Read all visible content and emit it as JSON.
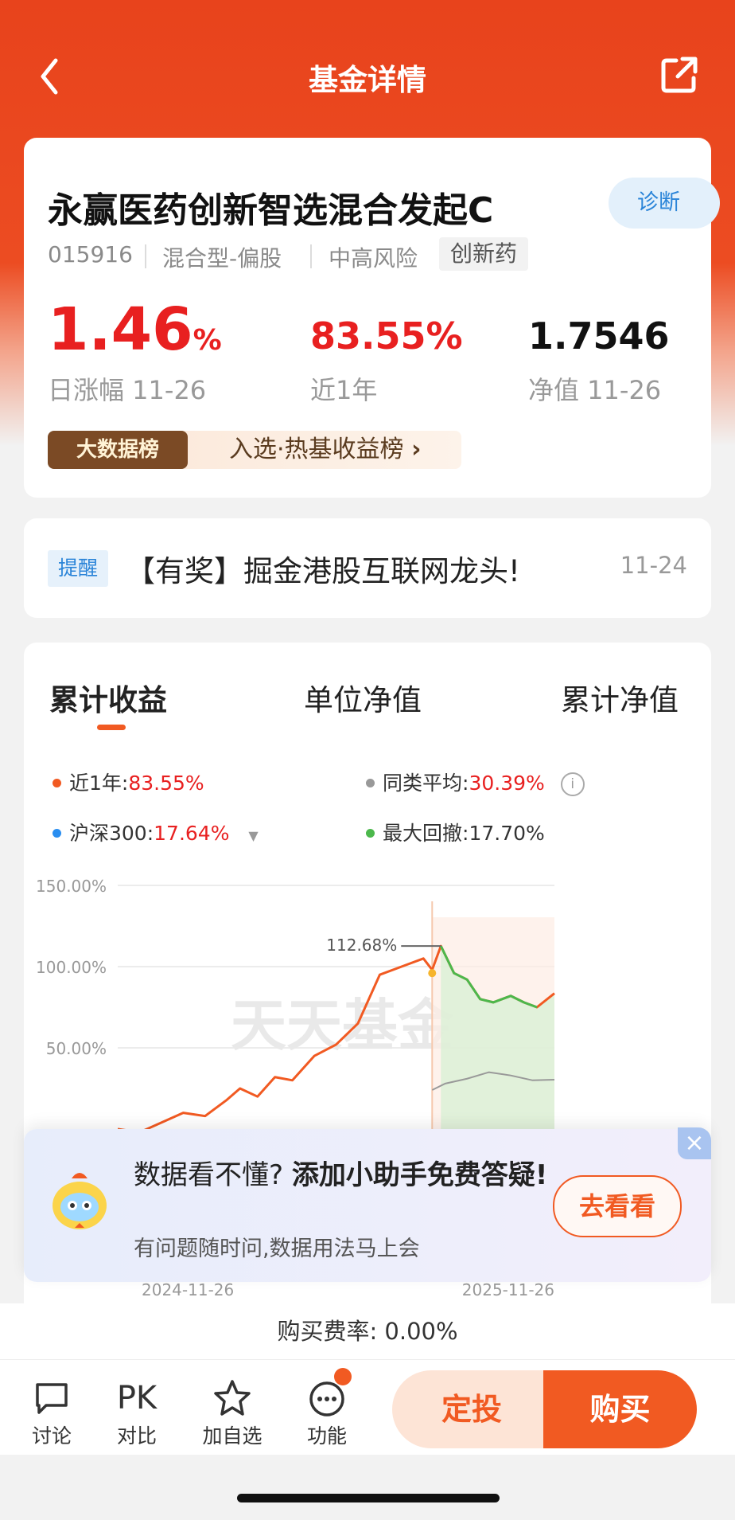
{
  "nav": {
    "title": "基金详情"
  },
  "fund": {
    "name": "永赢医药创新智选混合发起C",
    "diagnose_label": "诊断",
    "code": "015916",
    "type": "混合型-偏股",
    "risk": "中高风险",
    "tag": "创新药",
    "daily_change": "1.46",
    "daily_change_unit": "%",
    "daily_change_label": "日涨幅 11-26",
    "one_year_return": "83.55%",
    "one_year_label": "近1年",
    "nav_value": "1.7546",
    "nav_label": "净值 11-26",
    "rank_badge": "大数据榜",
    "rank_text": "入选·热基收益榜"
  },
  "reminder": {
    "tag": "提醒",
    "text": "【有奖】掘金港股互联网龙头!",
    "date": "11-24"
  },
  "chart_tabs": [
    "累计收益",
    "单位净值",
    "累计净值"
  ],
  "legend": {
    "fund": {
      "label": "近1年:",
      "value": "83.55%"
    },
    "peer": {
      "label": "同类平均:",
      "value": "30.39%"
    },
    "index": {
      "label": "沪深300:",
      "value": "17.64%"
    },
    "drawdown": {
      "label": "最大回撤:",
      "value": "17.70%"
    }
  },
  "colors": {
    "primary": "#f15a22",
    "header": "#e8431c",
    "fund_line": "#f15a22",
    "peer_line": "#999999",
    "index_line": "#2a8ef0",
    "drawdown": "#4cb84c",
    "up": "#e82020"
  },
  "chart_data": {
    "type": "line",
    "y_ticks": [
      "150.00%",
      "100.00%",
      "50.00%"
    ],
    "ylim": [
      -10,
      150
    ],
    "x_labels": [
      "2024-11-26",
      "2025-11-26"
    ],
    "peak_label": "112.68%",
    "watermark": "天天基金",
    "series": [
      {
        "name": "近1年",
        "x": [
          0,
          0.05,
          0.1,
          0.15,
          0.2,
          0.25,
          0.28,
          0.32,
          0.36,
          0.4,
          0.45,
          0.5,
          0.55,
          0.6,
          0.65,
          0.7,
          0.72,
          0.74,
          0.77,
          0.8,
          0.83,
          0.86,
          0.9,
          0.93,
          0.96,
          1.0
        ],
        "values": [
          0,
          -2,
          4,
          10,
          8,
          18,
          25,
          20,
          32,
          30,
          45,
          52,
          65,
          95,
          100,
          105,
          98,
          112.68,
          96,
          92,
          80,
          78,
          82,
          78,
          75,
          83.55
        ]
      },
      {
        "name": "同类平均",
        "x": [
          0.72,
          0.75,
          0.8,
          0.85,
          0.9,
          0.95,
          1.0
        ],
        "values": [
          24,
          28,
          31,
          35,
          33,
          30,
          30.39
        ]
      }
    ],
    "max_drawdown": {
      "from": "112.68%",
      "value": "17.70%"
    }
  },
  "promo": {
    "title_plain": "数据看不懂?",
    "title_bold": "添加小助手免费答疑!",
    "subtitle": "有问题随时问,数据用法马上会",
    "button": "去看看",
    "close": "×"
  },
  "fee": "购买费率: 0.00%",
  "bottom_nav": [
    {
      "label": "讨论",
      "icon": "comment-icon"
    },
    {
      "label": "对比",
      "icon": "pk-icon",
      "icon_text": "PK"
    },
    {
      "label": "加自选",
      "icon": "star-icon"
    },
    {
      "label": "功能",
      "icon": "more-icon"
    }
  ],
  "actions": {
    "dingtou": "定投",
    "buy": "购买"
  }
}
